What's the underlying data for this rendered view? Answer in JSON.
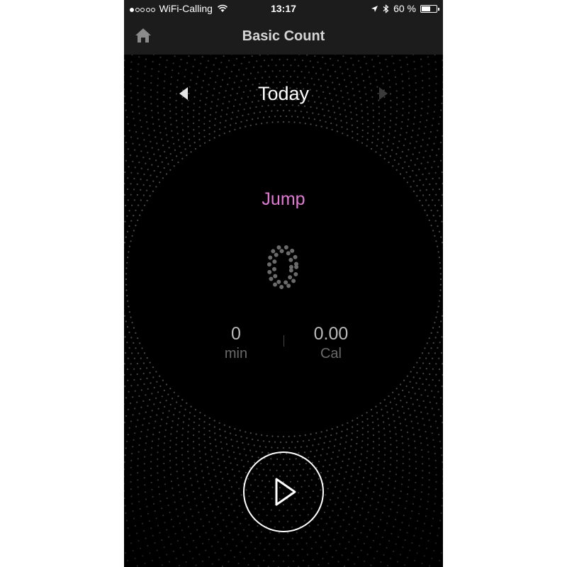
{
  "status_bar": {
    "signal_dots_filled": 1,
    "signal_dots_total": 5,
    "carrier": "WiFi-Calling",
    "time": "13:17",
    "battery": "60 %",
    "battery_level": 0.6
  },
  "navbar": {
    "title": "Basic Count",
    "home_icon": "home-icon"
  },
  "date_nav": {
    "label": "Today",
    "prev_icon": "chevron-left-icon",
    "next_icon": "chevron-right-icon"
  },
  "activity": {
    "mode": "Jump",
    "count": "0",
    "duration_value": "0",
    "duration_unit": "min",
    "calories_value": "0.00",
    "calories_unit": "Cal"
  },
  "controls": {
    "play_icon": "play-icon"
  },
  "colors": {
    "background": "#000000",
    "bar": "#1c1c1c",
    "accent": "#e07ad4",
    "dots": "#5a5a5a"
  }
}
